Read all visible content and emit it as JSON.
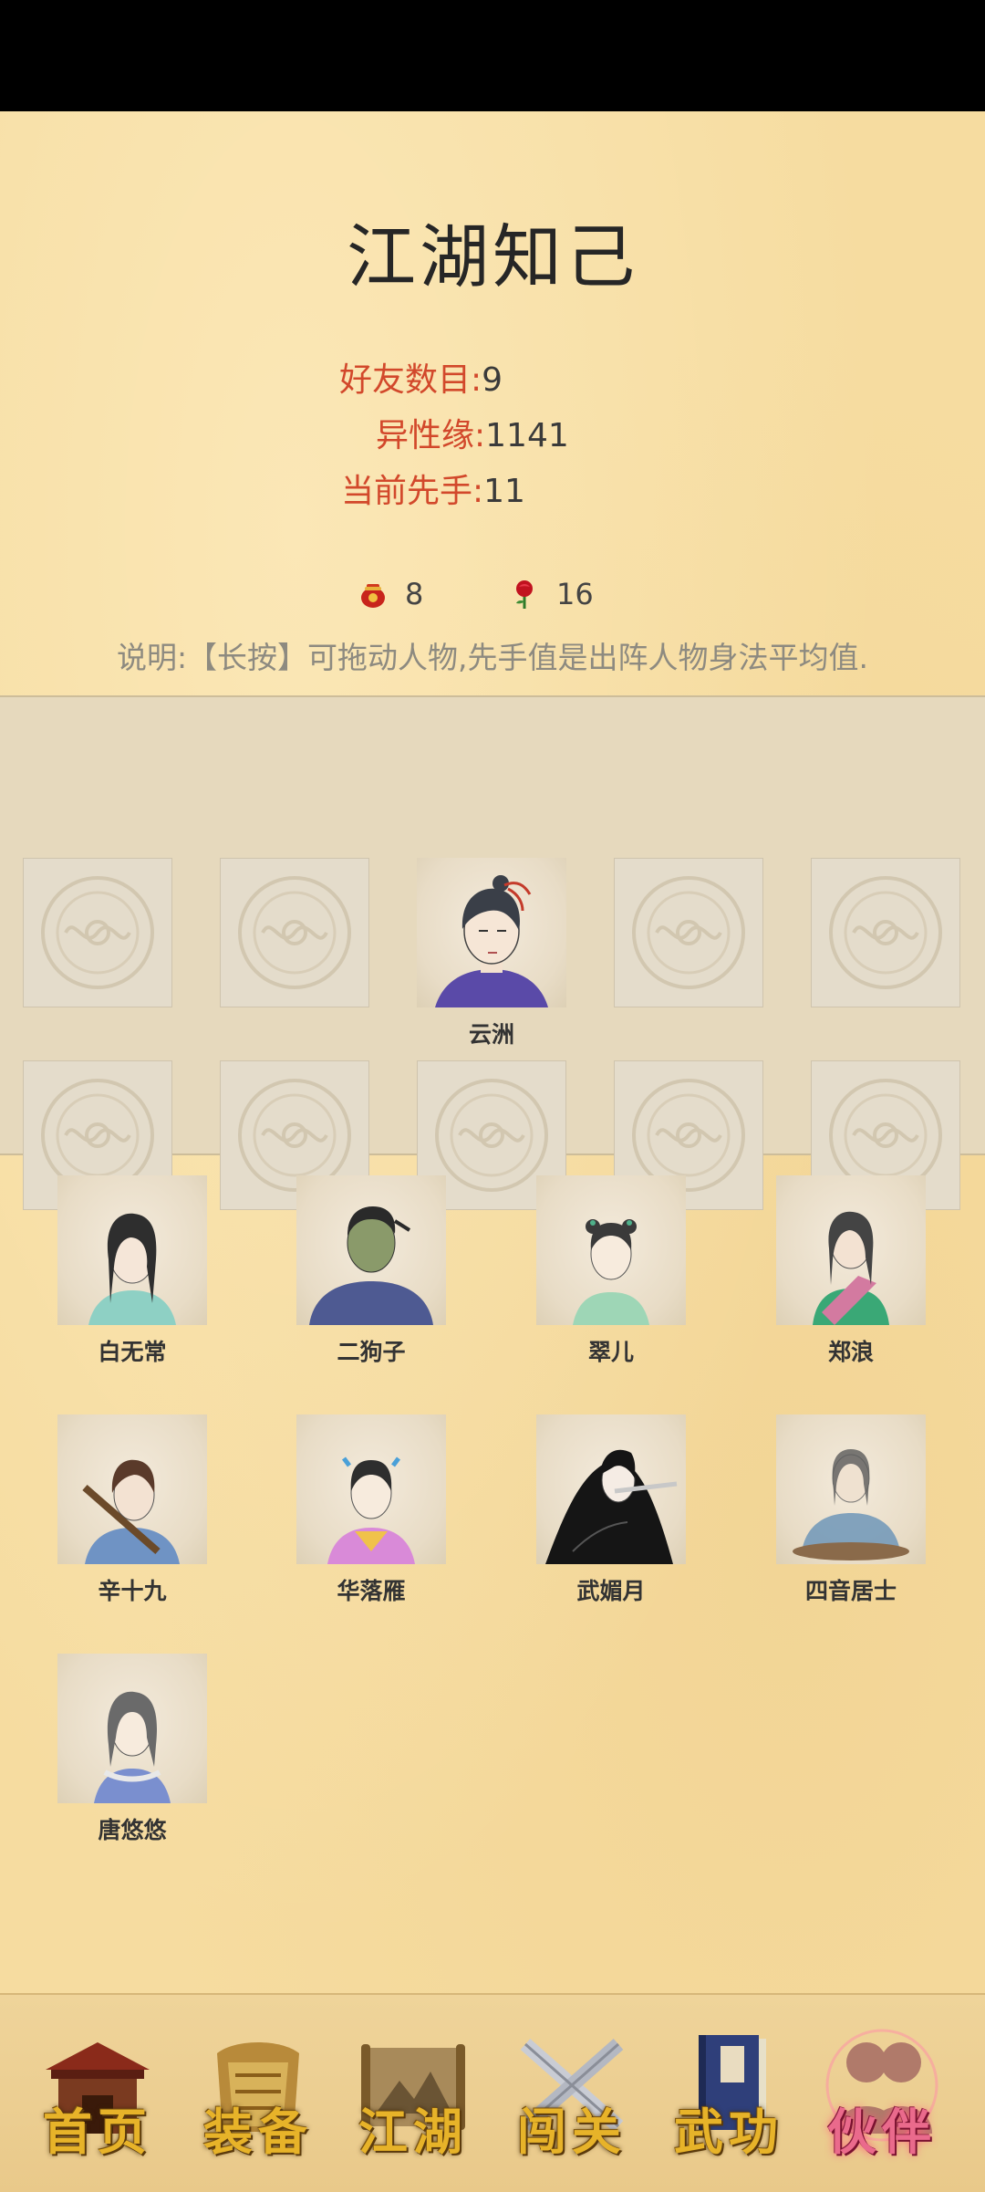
{
  "header": {
    "title": "江湖知己"
  },
  "stats": {
    "friends_label": "好友数目:",
    "friends_value": "9",
    "charm_label": "异性缘:",
    "charm_value": "1141",
    "initiative_label": "当前先手:",
    "initiative_value": "11"
  },
  "resources": {
    "pot": {
      "icon": "red-pot-icon",
      "count": "8"
    },
    "rose": {
      "icon": "rose-icon",
      "count": "16"
    }
  },
  "note": "说明:【长按】可拖动人物,先手值是出阵人物身法平均值.",
  "lineup": {
    "occupied_name": "云洲",
    "empty_icon": "empty-slot-medallion-icon"
  },
  "companions": [
    {
      "name": "白无常"
    },
    {
      "name": "二狗子"
    },
    {
      "name": "翠儿"
    },
    {
      "name": "郑浪"
    },
    {
      "name": "辛十九"
    },
    {
      "name": "华落雁"
    },
    {
      "name": "武媚月"
    },
    {
      "name": "四音居士"
    },
    {
      "name": "唐悠悠"
    }
  ],
  "nav": [
    {
      "label": "首页",
      "icon": "house-icon"
    },
    {
      "label": "装备",
      "icon": "armor-icon"
    },
    {
      "label": "江湖",
      "icon": "scroll-map-icon"
    },
    {
      "label": "闯关",
      "icon": "crossed-swords-icon"
    },
    {
      "label": "武功",
      "icon": "book-icon"
    },
    {
      "label": "伙伴",
      "icon": "partners-icon",
      "active": true
    }
  ],
  "colors": {
    "accent_red": "#d2482b",
    "nav_gold": "#e7b329",
    "background": "#f6dca0"
  }
}
